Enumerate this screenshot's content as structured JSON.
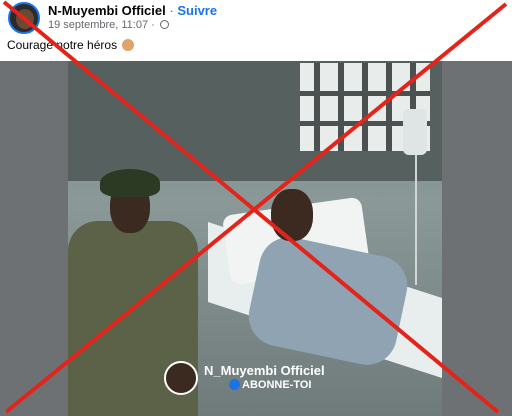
{
  "post": {
    "page_name": "N-Muyembi Officiel",
    "separator": "·",
    "follow_label": "Suivre",
    "timestamp": "19 septembre, 11:07",
    "meta_separator": "·",
    "audience_icon": "globe-icon",
    "caption": "Courage notre héros",
    "caption_emoji": "bowl-emoji"
  },
  "photo": {
    "watermark_name": "N_Muyembi Officiel",
    "watermark_cta": "ABONNE-TOI"
  },
  "overlay": {
    "cross_color": "#e3241b"
  },
  "colors": {
    "link": "#1b74e4",
    "text": "#050505",
    "muted": "#65676b"
  }
}
